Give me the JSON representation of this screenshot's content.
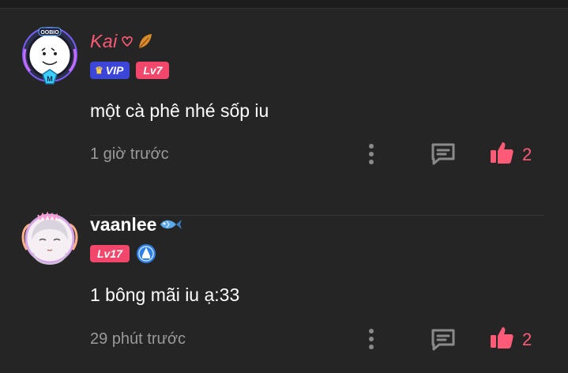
{
  "comments": [
    {
      "username": "Kai",
      "badges": {
        "vip_label": "VIP",
        "level_label": "Lv7"
      },
      "text": "một cà phê nhé sốp iu",
      "time": "1 giờ trước",
      "like_count": "2",
      "avatar_tag": "OOBIO",
      "username_color": "#ff5a76"
    },
    {
      "username": "vaanlee",
      "badges": {
        "level_label": "Lv17"
      },
      "text": "1 bông mãi iu ạ:33",
      "time": "29 phút trước",
      "like_count": "2",
      "username_color": "#ffffff"
    }
  ],
  "colors": {
    "background": "#252526",
    "accent": "#ff5a76",
    "level_badge": "#f2476a",
    "vip_badge": "#3c46d8",
    "muted_text": "#9a9a9a",
    "icon_gray": "#8a8a8a"
  },
  "icons": [
    "crown-icon",
    "more-icon",
    "reply-icon",
    "thumbs-up-icon",
    "verified-icon",
    "fish-icon",
    "leaf-icon",
    "heart-outline-icon"
  ]
}
